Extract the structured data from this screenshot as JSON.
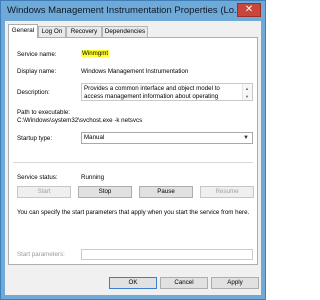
{
  "window": {
    "title": "Windows Management Instrumentation Properties (Lo...",
    "close": "✕"
  },
  "tabs": [
    "General",
    "Log On",
    "Recovery",
    "Dependencies"
  ],
  "general": {
    "service_name_label": "Service name:",
    "service_name_value": "Winmgmt",
    "display_name_label": "Display name:",
    "display_name_value": "Windows Management Instrumentation",
    "description_label": "Description:",
    "description_value": "Provides a common interface and object model to access management information about operating",
    "path_label": "Path to executable:",
    "path_value": "C:\\Windows\\system32\\svchost.exe -k netsvcs",
    "startup_type_label": "Startup type:",
    "startup_type_value": "Manual",
    "service_status_label": "Service status:",
    "service_status_value": "Running",
    "start_label": "Start",
    "stop_label": "Stop",
    "pause_label": "Pause",
    "resume_label": "Resume",
    "start_params_note": "You can specify the start parameters that apply when you start the service from here.",
    "start_params_label": "Start parameters:",
    "start_params_value": ""
  },
  "footer": {
    "ok_label": "OK",
    "cancel_label": "Cancel",
    "apply_label": "Apply"
  }
}
